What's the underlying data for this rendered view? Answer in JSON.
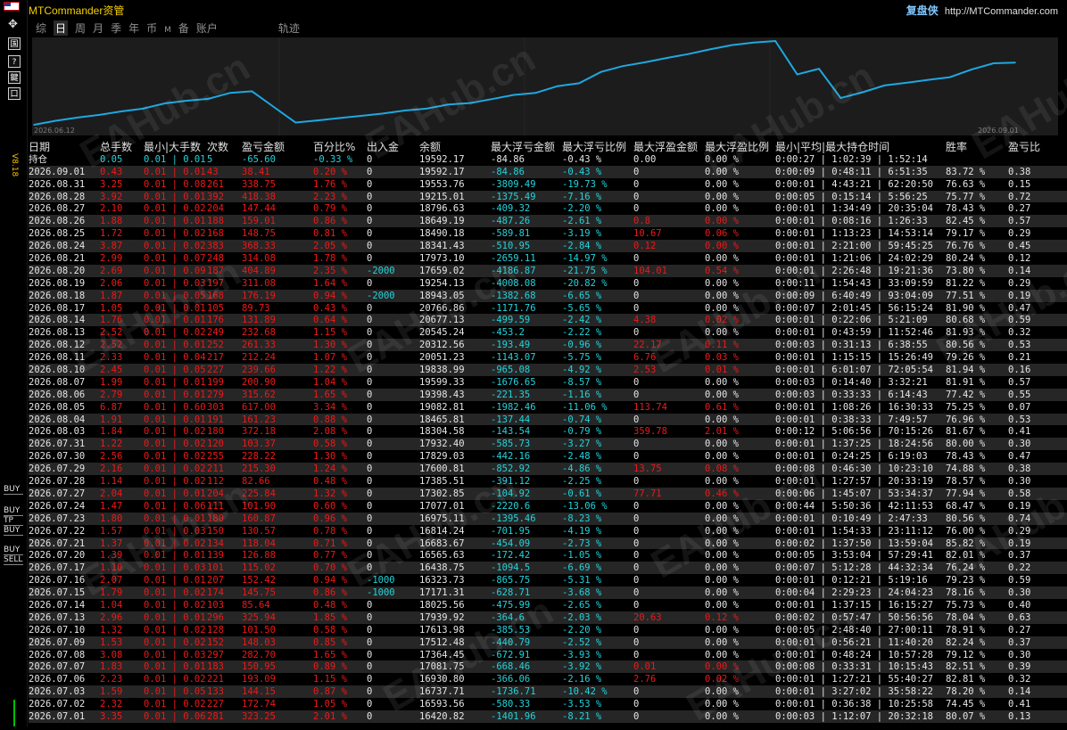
{
  "window": {
    "title": "MTCommander资管",
    "brand_name": "复盘侠",
    "brand_url": "http://MTCommander.com",
    "version": "V8.18"
  },
  "left_toolbar": {
    "buttons": [
      "国",
      "?",
      "鍵",
      "口"
    ],
    "trade_labels": [
      [
        "BUY"
      ],
      [
        "BUY",
        "TP"
      ],
      [
        "BUY"
      ],
      [
        "BUY",
        "SELL"
      ]
    ]
  },
  "periods": [
    {
      "label": "综",
      "active": false,
      "small": false
    },
    {
      "label": "日",
      "active": true,
      "small": false
    },
    {
      "label": "周",
      "active": false,
      "small": false
    },
    {
      "label": "月",
      "active": false,
      "small": false
    },
    {
      "label": "季",
      "active": false,
      "small": false
    },
    {
      "label": "年",
      "active": false,
      "small": false
    },
    {
      "label": "币",
      "active": false,
      "small": false
    },
    {
      "label": "M",
      "active": false,
      "small": true
    },
    {
      "label": "备",
      "active": false,
      "small": false
    },
    {
      "label": "账户",
      "active": false,
      "small": false
    },
    {
      "label": "轨迹",
      "active": false,
      "small": false
    }
  ],
  "chart_data": {
    "type": "line",
    "x_start": "2026.06.12",
    "x_end": "2026.09.01",
    "values": [
      16200,
      16420.82,
      16593.56,
      16737.71,
      16930.8,
      17081.75,
      17364.45,
      17512.48,
      17613.98,
      17939.92,
      18025.56,
      17171.31,
      16323.73,
      16438.75,
      16565.63,
      16683.67,
      16814.24,
      16975.11,
      17077.01,
      17302.85,
      17385.51,
      17600.81,
      17829.03,
      17932.4,
      18304.58,
      18465.81,
      19082.81,
      19398.43,
      19599.33,
      19838.99,
      20051.23,
      20312.56,
      20545.24,
      20677.13,
      20766.86,
      18943.05,
      19254.13,
      17659.02,
      17973.1,
      18341.43,
      18490.18,
      18649.19,
      18796.63,
      19215.01,
      19553.76,
      19592.17
    ],
    "line_color": "#1ea8e0"
  },
  "columns": [
    "日期",
    "总手数",
    "最小|大手数",
    "次数",
    "盈亏金额",
    "百分比%",
    "出入金",
    "余额",
    "最大浮亏金额",
    "最大浮亏比例",
    "最大浮盈金额",
    "最大浮盈比例",
    "最小|平均|最大持仓时间",
    "胜率",
    "盈亏比"
  ],
  "holding_row": [
    "持仓",
    "0.05",
    "0.01 | 0.01",
    "5",
    "-65.60",
    "-0.33 %",
    "0",
    "19592.17",
    "-84.86",
    "-0.43 %",
    "0.00",
    "0.00 %",
    "0:00:27 | 1:02:39 | 1:52:14",
    "",
    ""
  ],
  "rows": [
    [
      "2026.09.01",
      "0.43",
      "0.01 | 0.01",
      "43",
      "38.41",
      "0.20 %",
      "0",
      "19592.17",
      "-84.86",
      "-0.43 %",
      "0",
      "0.00 %",
      "0:00:09 | 0:48:11 | 6:51:35",
      "83.72 %",
      "0.38"
    ],
    [
      "2026.08.31",
      "3.25",
      "0.01 | 0.08",
      "261",
      "338.75",
      "1.76 %",
      "0",
      "19553.76",
      "-3809.49",
      "-19.73 %",
      "0",
      "0.00 %",
      "0:00:01 | 4:43:21 | 62:20:50",
      "76.63 %",
      "0.15"
    ],
    [
      "2026.08.28",
      "3.92",
      "0.01 | 0.01",
      "392",
      "418.38",
      "2.23 %",
      "0",
      "19215.01",
      "-1375.49",
      "-7.16 %",
      "0",
      "0.00 %",
      "0:00:05 | 0:15:14 | 5:56:25",
      "75.77 %",
      "0.72"
    ],
    [
      "2026.08.27",
      "2.10",
      "0.01 | 0.02",
      "204",
      "147.44",
      "0.79 %",
      "0",
      "18796.63",
      "-409.32",
      "-2.20 %",
      "0",
      "0.00 %",
      "0:00:01 | 1:34:49 | 20:35:04",
      "78.43 %",
      "0.27"
    ],
    [
      "2026.08.26",
      "1.88",
      "0.01 | 0.01",
      "188",
      "159.01",
      "0.86 %",
      "0",
      "18649.19",
      "-487.26",
      "-2.61 %",
      "0.8",
      "0.00 %",
      "0:00:01 | 0:08:16 | 1:26:33",
      "82.45 %",
      "0.57"
    ],
    [
      "2026.08.25",
      "1.72",
      "0.01 | 0.02",
      "168",
      "148.75",
      "0.81 %",
      "0",
      "18490.18",
      "-589.81",
      "-3.19 %",
      "10.67",
      "0.06 %",
      "0:00:01 | 1:13:23 | 14:53:14",
      "79.17 %",
      "0.29"
    ],
    [
      "2026.08.24",
      "3.87",
      "0.01 | 0.02",
      "383",
      "368.33",
      "2.05 %",
      "0",
      "18341.43",
      "-510.95",
      "-2.84 %",
      "0.12",
      "0.00 %",
      "0:00:01 | 2:21:00 | 59:45:25",
      "76.76 %",
      "0.45"
    ],
    [
      "2026.08.21",
      "2.99",
      "0.01 | 0.07",
      "248",
      "314.08",
      "1.78 %",
      "0",
      "17973.10",
      "-2659.11",
      "-14.97 %",
      "0",
      "0.00 %",
      "0:00:01 | 1:21:06 | 24:02:29",
      "80.24 %",
      "0.12"
    ],
    [
      "2026.08.20",
      "2.69",
      "0.01 | 0.09",
      "187",
      "404.89",
      "2.35 %",
      "-2000",
      "17659.02",
      "-4186.87",
      "-21.75 %",
      "104.01",
      "0.54 %",
      "0:00:01 | 2:26:48 | 19:21:36",
      "73.80 %",
      "0.14"
    ],
    [
      "2026.08.19",
      "2.06",
      "0.01 | 0.03",
      "197",
      "311.08",
      "1.64 %",
      "0",
      "19254.13",
      "-4008.08",
      "-20.82 %",
      "0",
      "0.00 %",
      "0:00:11 | 1:54:43 | 33:09:59",
      "81.22 %",
      "0.29"
    ],
    [
      "2026.08.18",
      "1.87",
      "0.01 | 0.05",
      "168",
      "176.19",
      "0.94 %",
      "-2000",
      "18943.05",
      "-1382.68",
      "-6.65 %",
      "0",
      "0.00 %",
      "0:00:09 | 6:40:49 | 93:04:09",
      "77.51 %",
      "0.19"
    ],
    [
      "2026.08.17",
      "1.05",
      "0.01 | 0.01",
      "105",
      "89.73",
      "0.43 %",
      "0",
      "20766.86",
      "-1171.76",
      "-5.65 %",
      "0",
      "0.00 %",
      "0:00:07 | 2:01:45 | 56:15:24",
      "81.90 %",
      "0.47"
    ],
    [
      "2026.08.14",
      "1.76",
      "0.01 | 0.01",
      "176",
      "131.89",
      "0.64 %",
      "0",
      "20677.13",
      "-499.59",
      "-2.42 %",
      "4.38",
      "0.02 %",
      "0:00:01 | 0:22:06 | 5:21:09",
      "80.68 %",
      "0.59"
    ],
    [
      "2026.08.13",
      "2.52",
      "0.01 | 0.02",
      "249",
      "232.68",
      "1.15 %",
      "0",
      "20545.24",
      "-453.2",
      "-2.22 %",
      "0",
      "0.00 %",
      "0:00:01 | 0:43:59 | 11:52:46",
      "81.93 %",
      "0.32"
    ],
    [
      "2026.08.12",
      "2.52",
      "0.01 | 0.01",
      "252",
      "261.33",
      "1.30 %",
      "0",
      "20312.56",
      "-193.49",
      "-0.96 %",
      "22.17",
      "0.11 %",
      "0:00:03 | 0:31:13 | 6:38:55",
      "80.56 %",
      "0.53"
    ],
    [
      "2026.08.11",
      "2.33",
      "0.01 | 0.04",
      "217",
      "212.24",
      "1.07 %",
      "0",
      "20051.23",
      "-1143.07",
      "-5.75 %",
      "6.76",
      "0.03 %",
      "0:00:01 | 1:15:15 | 15:26:49",
      "79.26 %",
      "0.21"
    ],
    [
      "2026.08.10",
      "2.45",
      "0.01 | 0.05",
      "227",
      "239.66",
      "1.22 %",
      "0",
      "19838.99",
      "-965.08",
      "-4.92 %",
      "2.53",
      "0.01 %",
      "0:00:01 | 6:01:07 | 72:05:54",
      "81.94 %",
      "0.16"
    ],
    [
      "2026.08.07",
      "1.99",
      "0.01 | 0.01",
      "199",
      "200.90",
      "1.04 %",
      "0",
      "19599.33",
      "-1676.65",
      "-8.57 %",
      "0",
      "0.00 %",
      "0:00:03 | 0:14:40 | 3:32:21",
      "81.91 %",
      "0.57"
    ],
    [
      "2026.08.06",
      "2.79",
      "0.01 | 0.01",
      "279",
      "315.62",
      "1.65 %",
      "0",
      "19398.43",
      "-221.35",
      "-1.16 %",
      "0",
      "0.00 %",
      "0:00:03 | 0:33:33 | 6:14:43",
      "77.42 %",
      "0.55"
    ],
    [
      "2026.08.05",
      "6.87",
      "0.01 | 0.60",
      "303",
      "617.00",
      "3.34 %",
      "0",
      "19082.81",
      "-1982.46",
      "-11.06 %",
      "113.74",
      "0.61 %",
      "0:00:01 | 1:08:26 | 16:30:33",
      "75.25 %",
      "0.07"
    ],
    [
      "2026.08.04",
      "1.91",
      "0.01 | 0.01",
      "191",
      "161.23",
      "0.88 %",
      "0",
      "18465.81",
      "-137.44",
      "-0.74 %",
      "0",
      "0.00 %",
      "0:00:01 | 0:38:33 | 7:49:57",
      "76.96 %",
      "0.53"
    ],
    [
      "2026.08.03",
      "1.84",
      "0.01 | 0.02",
      "180",
      "372.18",
      "2.08 %",
      "0",
      "18304.58",
      "-143.54",
      "-0.79 %",
      "359.78",
      "2.01 %",
      "0:00:12 | 5:06:56 | 70:15:26",
      "81.67 %",
      "0.41"
    ],
    [
      "2026.07.31",
      "1.22",
      "0.01 | 0.02",
      "120",
      "103.37",
      "0.58 %",
      "0",
      "17932.40",
      "-585.73",
      "-3.27 %",
      "0",
      "0.00 %",
      "0:00:01 | 1:37:25 | 18:24:56",
      "80.00 %",
      "0.30"
    ],
    [
      "2026.07.30",
      "2.56",
      "0.01 | 0.02",
      "255",
      "228.22",
      "1.30 %",
      "0",
      "17829.03",
      "-442.16",
      "-2.48 %",
      "0",
      "0.00 %",
      "0:00:01 | 0:24:25 | 6:19:03",
      "78.43 %",
      "0.47"
    ],
    [
      "2026.07.29",
      "2.16",
      "0.01 | 0.02",
      "211",
      "215.30",
      "1.24 %",
      "0",
      "17600.81",
      "-852.92",
      "-4.86 %",
      "13.75",
      "0.08 %",
      "0:00:08 | 0:46:30 | 10:23:10",
      "74.88 %",
      "0.38"
    ],
    [
      "2026.07.28",
      "1.14",
      "0.01 | 0.02",
      "112",
      "82.66",
      "0.48 %",
      "0",
      "17385.51",
      "-391.12",
      "-2.25 %",
      "0",
      "0.00 %",
      "0:00:01 | 1:27:57 | 20:33:19",
      "78.57 %",
      "0.30"
    ],
    [
      "2026.07.27",
      "2.04",
      "0.01 | 0.01",
      "204",
      "225.84",
      "1.32 %",
      "0",
      "17302.85",
      "-104.92",
      "-0.61 %",
      "77.71",
      "0.46 %",
      "0:00:06 | 1:45:07 | 53:34:37",
      "77.94 %",
      "0.58"
    ],
    [
      "2026.07.24",
      "1.47",
      "0.01 | 0.06",
      "111",
      "101.90",
      "0.60 %",
      "0",
      "17077.01",
      "-2220.6",
      "-13.06 %",
      "0",
      "0.00 %",
      "0:00:44 | 5:50:36 | 42:11:53",
      "68.47 %",
      "0.19"
    ],
    [
      "2026.07.23",
      "1.80",
      "0.01 | 0.01",
      "180",
      "160.87",
      "0.96 %",
      "0",
      "16975.11",
      "-1395.46",
      "-8.23 %",
      "0",
      "0.00 %",
      "0:00:01 | 0:10:49 | 2:47:33",
      "80.56 %",
      "0.74"
    ],
    [
      "2026.07.22",
      "1.57",
      "0.01 | 0.03",
      "150",
      "130.57",
      "0.78 %",
      "0",
      "16814.24",
      "-701.95",
      "-4.19 %",
      "0",
      "0.00 %",
      "0:00:01 | 1:54:33 | 23:11:12",
      "76.00 %",
      "0.29"
    ],
    [
      "2026.07.21",
      "1.37",
      "0.01 | 0.02",
      "134",
      "118.04",
      "0.71 %",
      "0",
      "16683.67",
      "-454.09",
      "-2.73 %",
      "0",
      "0.00 %",
      "0:00:02 | 1:37:50 | 13:59:04",
      "85.82 %",
      "0.19"
    ],
    [
      "2026.07.20",
      "1.39",
      "0.01 | 0.01",
      "139",
      "126.88",
      "0.77 %",
      "0",
      "16565.63",
      "-172.42",
      "-1.05 %",
      "0",
      "0.00 %",
      "0:00:05 | 3:53:04 | 57:29:41",
      "82.01 %",
      "0.37"
    ],
    [
      "2026.07.17",
      "1.10",
      "0.01 | 0.03",
      "101",
      "115.02",
      "0.70 %",
      "0",
      "16438.75",
      "-1094.5",
      "-6.69 %",
      "0",
      "0.00 %",
      "0:00:07 | 5:12:28 | 44:32:34",
      "76.24 %",
      "0.22"
    ],
    [
      "2026.07.16",
      "2.07",
      "0.01 | 0.01",
      "207",
      "152.42",
      "0.94 %",
      "-1000",
      "16323.73",
      "-865.75",
      "-5.31 %",
      "0",
      "0.00 %",
      "0:00:01 | 0:12:21 | 5:19:16",
      "79.23 %",
      "0.59"
    ],
    [
      "2026.07.15",
      "1.79",
      "0.01 | 0.02",
      "174",
      "145.75",
      "0.86 %",
      "-1000",
      "17171.31",
      "-628.71",
      "-3.68 %",
      "0",
      "0.00 %",
      "0:00:04 | 2:29:23 | 24:04:23",
      "78.16 %",
      "0.30"
    ],
    [
      "2026.07.14",
      "1.04",
      "0.01 | 0.02",
      "103",
      "85.64",
      "0.48 %",
      "0",
      "18025.56",
      "-475.99",
      "-2.65 %",
      "0",
      "0.00 %",
      "0:00:01 | 1:37:15 | 16:15:27",
      "75.73 %",
      "0.40"
    ],
    [
      "2026.07.13",
      "2.96",
      "0.01 | 0.01",
      "296",
      "325.94",
      "1.85 %",
      "0",
      "17939.92",
      "-364.6",
      "-2.03 %",
      "20.63",
      "0.12 %",
      "0:00:02 | 0:57:47 | 50:56:56",
      "78.04 %",
      "0.63"
    ],
    [
      "2026.07.10",
      "1.32",
      "0.01 | 0.02",
      "128",
      "101.50",
      "0.58 %",
      "0",
      "17613.98",
      "-385.53",
      "-2.20 %",
      "0",
      "0.00 %",
      "0:00:05 | 2:48:40 | 27:00:11",
      "78.91 %",
      "0.27"
    ],
    [
      "2026.07.09",
      "1.53",
      "0.01 | 0.02",
      "152",
      "148.03",
      "0.85 %",
      "0",
      "17512.48",
      "-440.79",
      "-2.52 %",
      "0",
      "0.00 %",
      "0:00:01 | 0:56:21 | 11:40:20",
      "82.24 %",
      "0.37"
    ],
    [
      "2026.07.08",
      "3.08",
      "0.01 | 0.03",
      "297",
      "282.70",
      "1.65 %",
      "0",
      "17364.45",
      "-672.91",
      "-3.93 %",
      "0",
      "0.00 %",
      "0:00:01 | 0:48:24 | 10:57:28",
      "79.12 %",
      "0.30"
    ],
    [
      "2026.07.07",
      "1.83",
      "0.01 | 0.01",
      "183",
      "150.95",
      "0.89 %",
      "0",
      "17081.75",
      "-668.46",
      "-3.92 %",
      "0.01",
      "0.00 %",
      "0:00:08 | 0:33:31 | 10:15:43",
      "82.51 %",
      "0.39"
    ],
    [
      "2026.07.06",
      "2.23",
      "0.01 | 0.02",
      "221",
      "193.09",
      "1.15 %",
      "0",
      "16930.80",
      "-366.06",
      "-2.16 %",
      "2.76",
      "0.02 %",
      "0:00:01 | 1:27:21 | 55:40:27",
      "82.81 %",
      "0.32"
    ],
    [
      "2026.07.03",
      "1.59",
      "0.01 | 0.05",
      "133",
      "144.15",
      "0.87 %",
      "0",
      "16737.71",
      "-1736.71",
      "-10.42 %",
      "0",
      "0.00 %",
      "0:00:01 | 3:27:02 | 35:58:22",
      "78.20 %",
      "0.14"
    ],
    [
      "2026.07.02",
      "2.32",
      "0.01 | 0.02",
      "227",
      "172.74",
      "1.05 %",
      "0",
      "16593.56",
      "-580.33",
      "-3.53 %",
      "0",
      "0.00 %",
      "0:00:01 | 0:36:38 | 10:25:58",
      "74.45 %",
      "0.41"
    ],
    [
      "2026.07.01",
      "3.35",
      "0.01 | 0.06",
      "281",
      "323.25",
      "2.01 %",
      "0",
      "16420.82",
      "-1401.96",
      "-8.21 %",
      "0",
      "0.00 %",
      "0:00:03 | 1:12:07 | 20:32:18",
      "80.07 %",
      "0.13"
    ]
  ],
  "watermark_text": "EAHub.cn"
}
